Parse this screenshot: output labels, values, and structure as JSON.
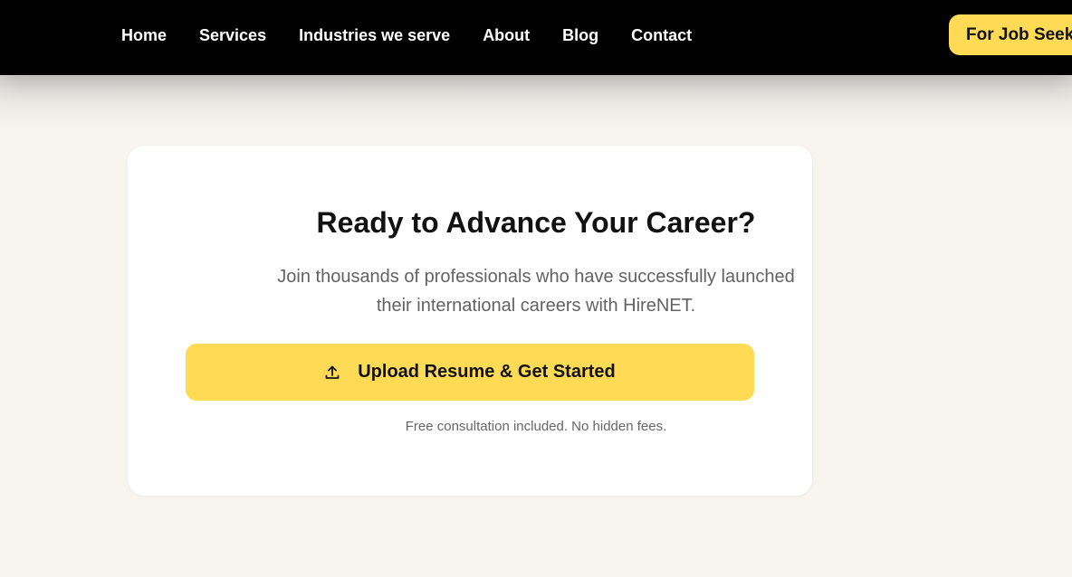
{
  "nav": {
    "links": [
      "Home",
      "Services",
      "Industries we serve",
      "About",
      "Blog",
      "Contact"
    ],
    "cta_label": "For Job Seekers"
  },
  "hero_card": {
    "title": "Ready to Advance Your Career?",
    "subtitle_line1": "Join thousands of professionals who have successfully launched",
    "subtitle_line2": "their international careers with HireNET.",
    "button_label": "Upload Resume & Get Started",
    "button_icon": "upload-icon",
    "note": "Free consultation included. No hidden fees."
  },
  "colors": {
    "accent": "#ffda55",
    "nav_background": "#000000",
    "page_background": "#f8f5f0",
    "card_background": "#ffffff"
  }
}
